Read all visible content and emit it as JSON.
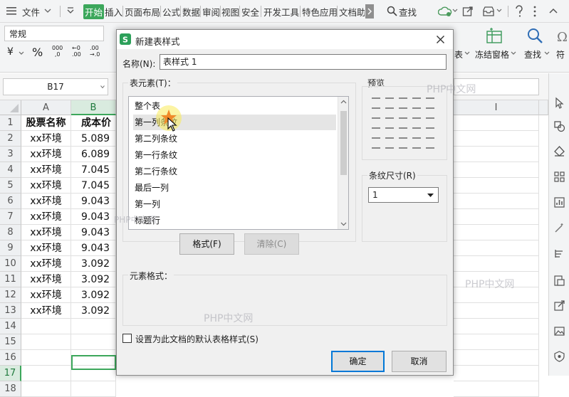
{
  "menubar": {
    "file": "文件",
    "tabs": [
      "开始",
      "插入",
      "页面布局",
      "公式",
      "数据",
      "审阅",
      "视图",
      "安全",
      "开发工具",
      "特色应用",
      "文档助"
    ],
    "search": "查找"
  },
  "toolbar": {
    "number_format": "常规",
    "currency_symbol": "¥",
    "percent": "%",
    "thousands": "000",
    "freeze_label": "冻结窗格",
    "find_label": "查找",
    "sym_label": "符",
    "table_label": "表"
  },
  "formula_bar": {
    "cell_ref": "B17"
  },
  "sheet": {
    "columns": [
      "A",
      "B",
      "I"
    ],
    "rows": [
      "1",
      "2",
      "3",
      "4",
      "5",
      "6",
      "7",
      "8",
      "9",
      "10",
      "11",
      "12",
      "13",
      "14",
      "15",
      "16",
      "17",
      "18"
    ],
    "header": [
      "股票名称",
      "成本价"
    ],
    "data": [
      [
        "xx环境",
        "5.089"
      ],
      [
        "xx环境",
        "6.089"
      ],
      [
        "xx环境",
        "7.045"
      ],
      [
        "xx环境",
        "7.045"
      ],
      [
        "xx环境",
        "9.043"
      ],
      [
        "xx环境",
        "9.043"
      ],
      [
        "xx环境",
        "9.043"
      ],
      [
        "xx环境",
        "9.043"
      ],
      [
        "xx环境",
        "3.092"
      ],
      [
        "xx环境",
        "3.092"
      ],
      [
        "xx环境",
        "3.092"
      ],
      [
        "xx环境",
        "3.092"
      ]
    ]
  },
  "dialog": {
    "title": "新建表样式",
    "name_label": "名称(N):",
    "name_value": "表样式 1",
    "elements_label": "表元素(T)：",
    "elements": [
      "整个表",
      "第一列条纹",
      "第二列条纹",
      "第一行条纹",
      "第二行条纹",
      "最后一列",
      "第一列",
      "标题行"
    ],
    "selected_index": 1,
    "preview_label": "预览",
    "stripe_label": "条纹尺寸(R)",
    "stripe_value": "1",
    "format_button": "格式(F)",
    "clear_button": "清除(C)",
    "element_format_label": "元素格式：",
    "default_checkbox_label": "设置为此文档的默认表格样式(S)",
    "ok_button": "确定",
    "cancel_button": "取消"
  },
  "watermarks": [
    "PHP中文网",
    "PHP中文网",
    "PHP中文网",
    "PHP中文网"
  ],
  "colors": {
    "accent_green": "#3ca75b",
    "selected_item_bg": "#e5e5e5",
    "primary_button_border": "#0078d7"
  }
}
